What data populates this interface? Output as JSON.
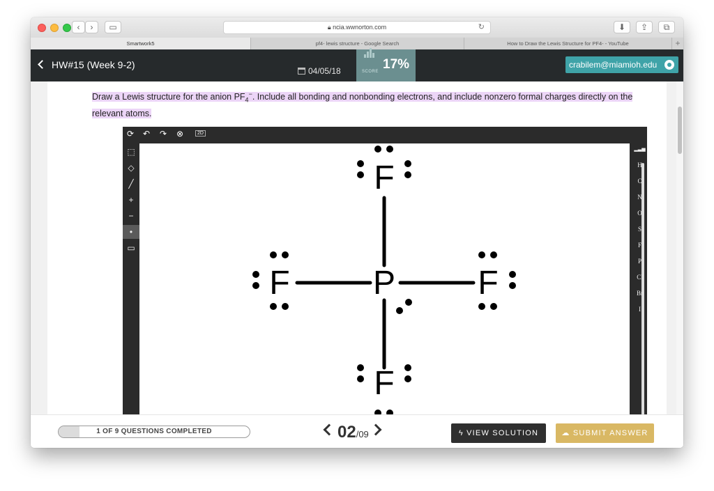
{
  "browser": {
    "url": "ncia.wwnorton.com",
    "tabs": [
      {
        "label": "Smartwork5"
      },
      {
        "label": "pf4- lewis structure - Google Search"
      },
      {
        "label": "How to Draw the Lewis Structure for PF4- - YouTube"
      }
    ]
  },
  "header": {
    "back_label": "HW#15 (Week 9-2)",
    "due_date": "04/05/18",
    "score_label": "SCORE",
    "score_value": "17%",
    "user_email": "crabilem@miamioh.edu"
  },
  "question": {
    "text_before": "Draw a Lewis structure for the anion PF",
    "subscript": "4",
    "superscript": "−",
    "text_after": ". Include all bonding and nonbonding electrons, and include nonzero formal charges directly on the relevant atoms."
  },
  "editor": {
    "tools_top": [
      "rotate-icon",
      "undo-icon",
      "redo-icon",
      "zoom-reset-icon",
      "2d-icon"
    ],
    "top_label_2d": "2D",
    "tools_left": [
      {
        "name": "select-icon",
        "glyph": "⬚"
      },
      {
        "name": "eraser-icon",
        "glyph": "◇"
      },
      {
        "name": "bond-icon",
        "glyph": "╱"
      },
      {
        "name": "positive-charge-icon",
        "glyph": "+"
      },
      {
        "name": "negative-charge-icon",
        "glyph": "−"
      },
      {
        "name": "electron-dot-icon",
        "glyph": "•"
      },
      {
        "name": "rectangle-icon",
        "glyph": "▭"
      }
    ],
    "selected_tool_index": 5,
    "atoms": [
      "H",
      "C",
      "N",
      "O",
      "S",
      "F",
      "P",
      "Cl",
      "Br",
      "I"
    ],
    "molecule": {
      "center": "P",
      "ligands": [
        "F",
        "F",
        "F",
        "F"
      ]
    }
  },
  "footer": {
    "progress_text": "1 OF 9 QUESTIONS COMPLETED",
    "progress_fraction": 0.11,
    "page_current": "02",
    "page_total": "/09",
    "view_solution": "VIEW SOLUTION",
    "submit_answer": "SUBMIT ANSWER"
  }
}
